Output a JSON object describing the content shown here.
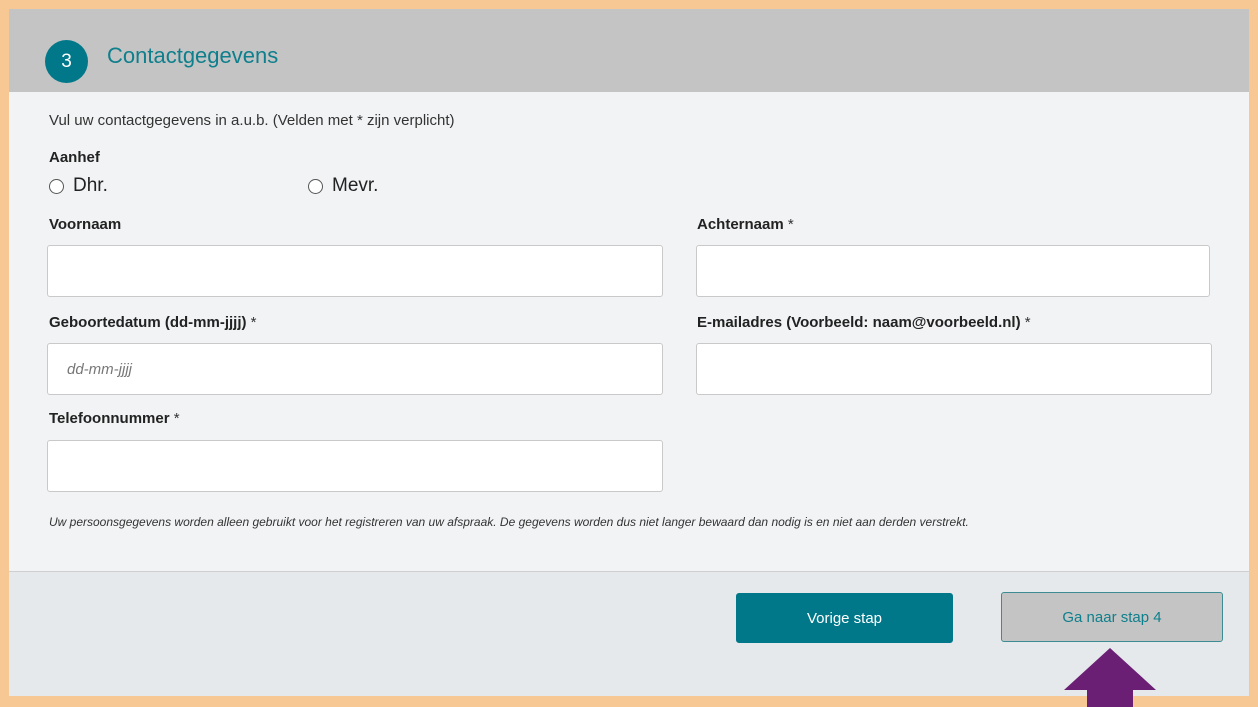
{
  "header": {
    "step_number": "3",
    "title": "Contactgegevens"
  },
  "form": {
    "intro": "Vul uw contactgegevens in a.u.b. (Velden met * zijn verplicht)",
    "salutation": {
      "label": "Aanhef",
      "options": [
        "Dhr.",
        "Mevr."
      ]
    },
    "first_name": {
      "label": "Voornaam",
      "value": ""
    },
    "last_name": {
      "label": "Achternaam",
      "required_mark": "*",
      "value": ""
    },
    "birthdate": {
      "label": "Geboortedatum (dd-mm-jjjj)",
      "required_mark": "*",
      "placeholder": "dd-mm-jjjj",
      "value": ""
    },
    "email": {
      "label": "E-mailadres (Voorbeeld: naam@voorbeeld.nl)",
      "required_mark": "*",
      "value": ""
    },
    "phone": {
      "label": "Telefoonnummer",
      "required_mark": "*",
      "value": ""
    },
    "privacy_note": "Uw persoonsgegevens worden alleen gebruikt voor het registreren van uw afspraak. De gegevens worden dus niet langer bewaard dan nodig is en niet aan derden verstrekt."
  },
  "footer": {
    "prev_label": "Vorige stap",
    "next_label": "Ga naar stap 4"
  },
  "colors": {
    "accent": "#00788a",
    "frame": "#f7c894",
    "header_bg": "#c4c4c4",
    "arrow": "#6a1e74"
  }
}
